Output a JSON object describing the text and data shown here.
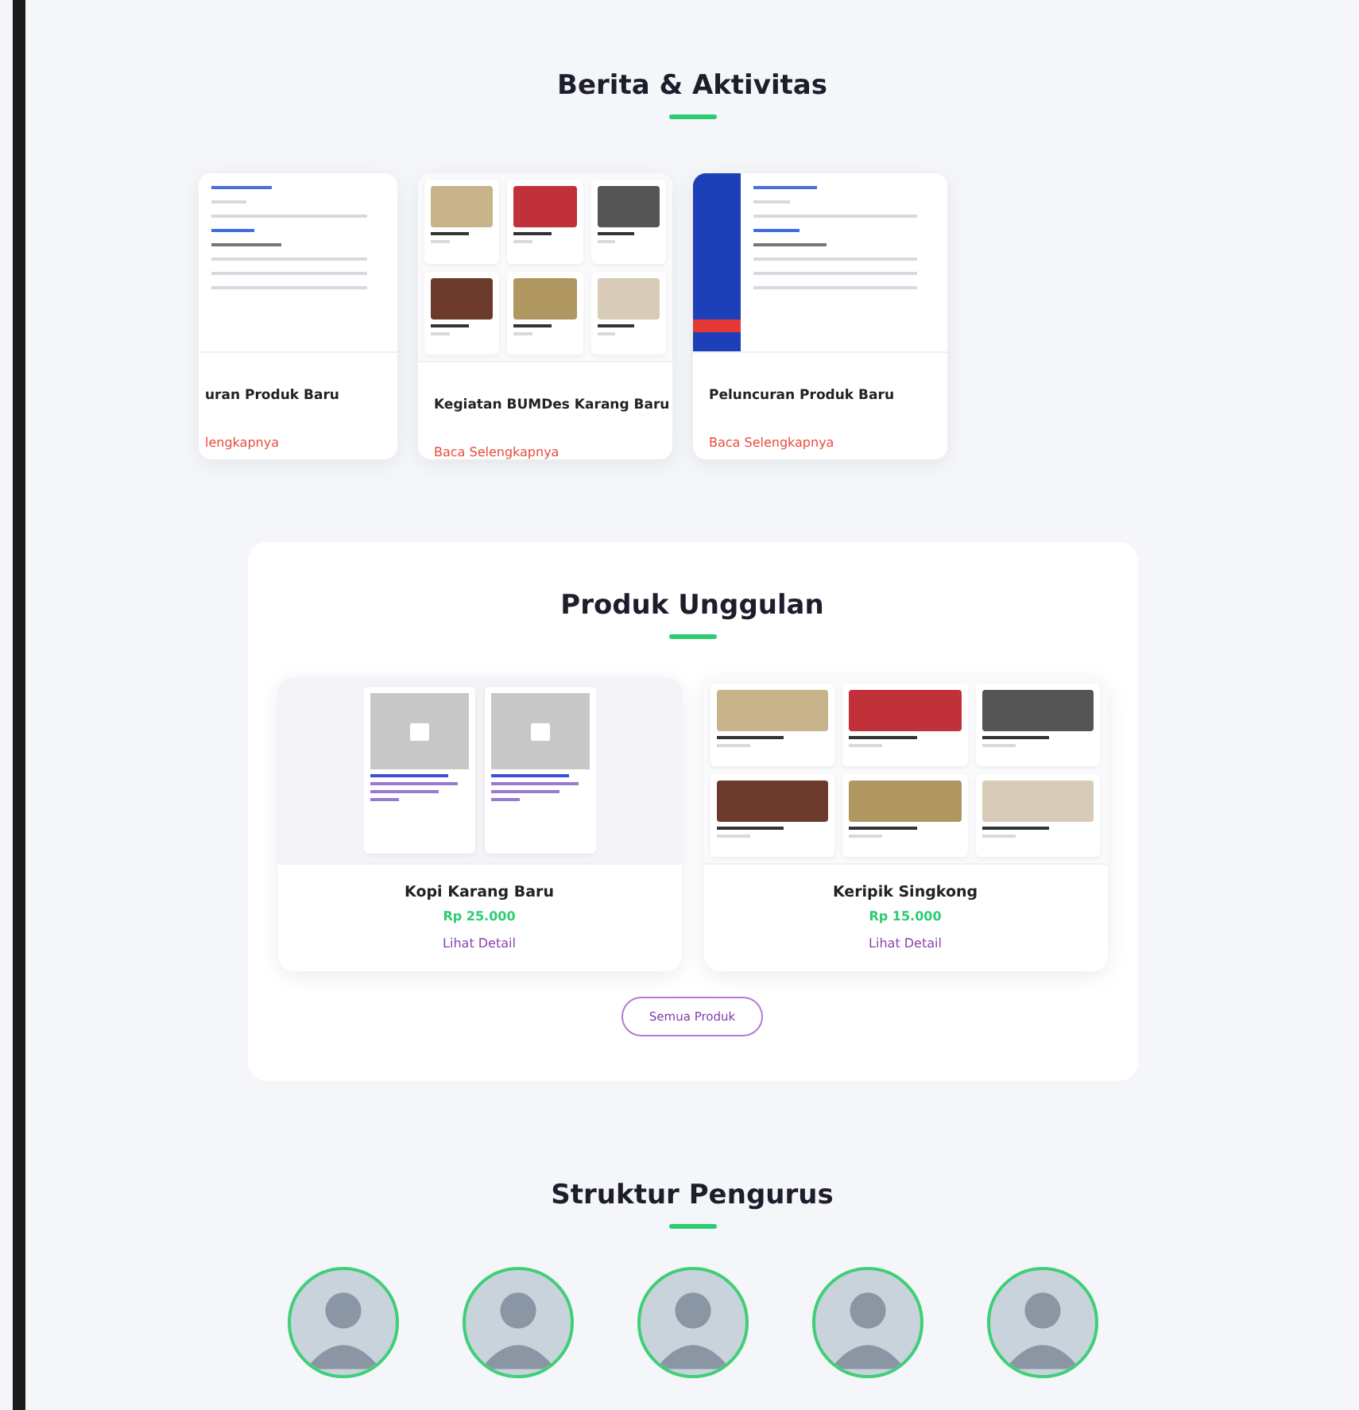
{
  "news": {
    "title": "Berita & Aktivitas",
    "cards": [
      {
        "kind": "admin-form",
        "title": "uran Produk Baru",
        "link": "lengkapnya",
        "cut": true
      },
      {
        "kind": "product-grid",
        "title": "Kegiatan BUMDes Karang Baru",
        "link": "Baca Selengkapnya",
        "cut": false
      },
      {
        "kind": "admin-panel",
        "title": "Peluncuran Produk Baru",
        "link": "Baca Selengkapnya",
        "cut": false
      }
    ]
  },
  "products": {
    "title": "Produk Unggulan",
    "cards": [
      {
        "kind": "placeholder-grid",
        "name": "Kopi Karang Baru",
        "price": "Rp 25.000",
        "link": "Lihat Detail"
      },
      {
        "kind": "product-grid",
        "name": "Keripik Singkong",
        "price": "Rp 15.000",
        "link": "Lihat Detail"
      }
    ],
    "button": "Semua Produk"
  },
  "structure": {
    "title": "Struktur Pengurus",
    "members": [
      {
        "kind": "photo"
      },
      {
        "kind": "photo"
      },
      {
        "kind": "photo"
      },
      {
        "kind": "photo"
      },
      {
        "kind": "photo"
      }
    ]
  }
}
